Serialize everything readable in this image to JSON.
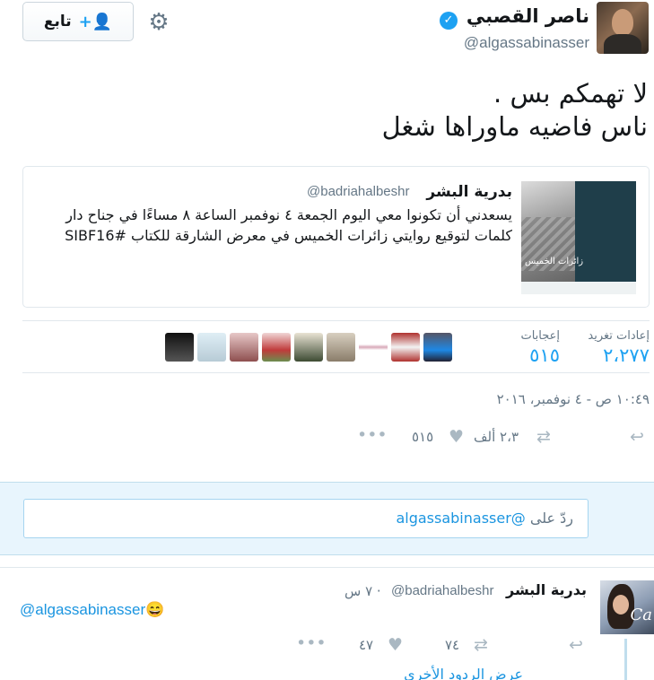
{
  "tweet": {
    "author_name": "ناصر القصبي",
    "author_handle": "@algassabinasser",
    "follow_label": "تابع",
    "text_line1": "لا تهمكم  بس .",
    "text_line2": "ناس فاضيه ماوراها شغل",
    "timestamp": "١٠:٤٩ ص - ٤ نوفمبر، ٢٠١٦"
  },
  "quote": {
    "author_name": "بدرية البشر",
    "author_handle": "@badriahalbeshr",
    "text": "يسعدني أن تكونوا معي  اليوم الجمعة ٤ نوفمبر الساعة ٨ مساءًا في جناح دار كلمات لتوقيع روايتي  زائرات الخميس في معرض الشارقة للكتاب  #SIBF16",
    "image_title": "زائرات الخميس"
  },
  "stats": {
    "retweets_label": "إعادات تغريد",
    "retweets_value": "٢،٢٧٧",
    "likes_label": "إعجابات",
    "likes_value": "٥١٥"
  },
  "actions": {
    "retweet_count": "٢،٣ ألف",
    "like_count": "٥١٥"
  },
  "reply_box": {
    "placeholder_prefix": "ردّ على",
    "mention": "@algassabinasser"
  },
  "reply": {
    "author_name": "بدرية البشر",
    "author_handle": "@badriahalbeshr",
    "time": "· ٧ س",
    "text": "@algassabinasser😄",
    "retweet_count": "٧٤",
    "like_count": "٤٧",
    "more_replies": "عرض الردود الأخرى"
  },
  "colors": {
    "accent": "#1da1f2",
    "link": "#1b95e0",
    "muted": "#657786",
    "icon": "#aab8c2"
  }
}
